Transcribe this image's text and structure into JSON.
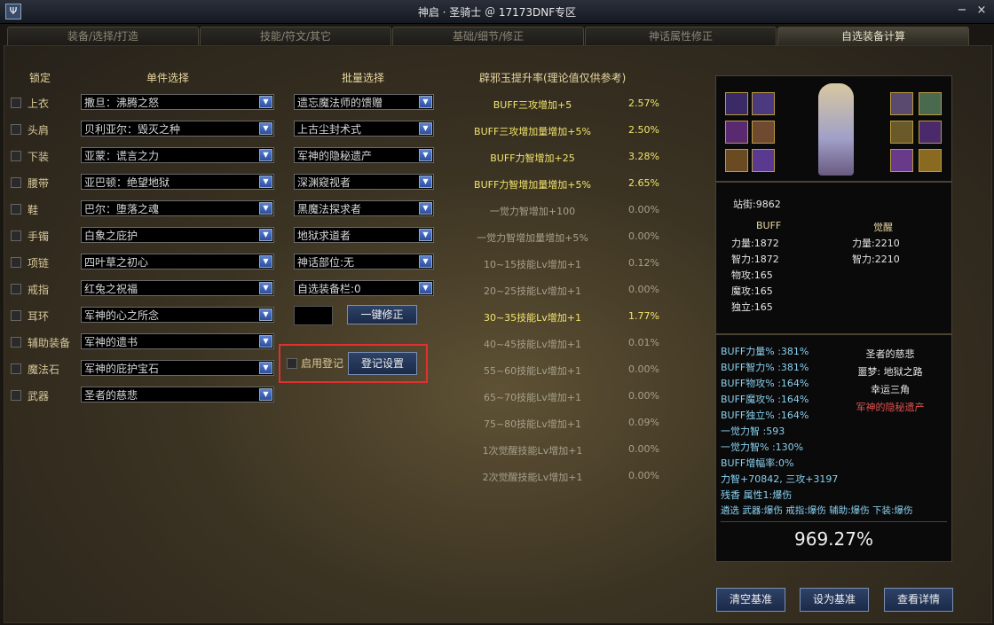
{
  "window": {
    "title": "神启 · 圣骑士 ＠ 17173DNF专区",
    "minimize": "−",
    "close": "×",
    "app_icon": "Ψ"
  },
  "tabs": [
    "装备/选择/打造",
    "技能/符文/其它",
    "基础/细节/修正",
    "神话属性修正",
    "自选装备计算"
  ],
  "active_tab": 4,
  "headers": {
    "lock": "锁定",
    "single": "单件选择",
    "batch": "批量选择",
    "rate": "辟邪玉提升率(理论值仅供参考)"
  },
  "slots": [
    {
      "label": "上衣",
      "item": "撒旦：沸腾之怒"
    },
    {
      "label": "头肩",
      "item": "贝利亚尔：毁灭之种"
    },
    {
      "label": "下装",
      "item": "亚蒙：谎言之力"
    },
    {
      "label": "腰带",
      "item": "亚巴顿：绝望地狱"
    },
    {
      "label": "鞋",
      "item": "巴尔：堕落之魂"
    },
    {
      "label": "手镯",
      "item": "白象之庇护"
    },
    {
      "label": "项链",
      "item": "四叶草之初心"
    },
    {
      "label": "戒指",
      "item": "红兔之祝福"
    },
    {
      "label": "耳环",
      "item": "军神的心之所念"
    },
    {
      "label": "辅助装备",
      "item": "军神的遗书"
    },
    {
      "label": "魔法石",
      "item": "军神的庇护宝石"
    },
    {
      "label": "武器",
      "item": "圣者的慈悲"
    }
  ],
  "batch": [
    "遗忘魔法师的馈赠",
    "上古尘封术式",
    "军神的隐秘遗产",
    "深渊窥视者",
    "黑魔法探求者",
    "地狱求道者",
    "神话部位:无",
    "自选装备栏:0"
  ],
  "buttons": {
    "one_key": "一键修正",
    "register_label": "启用登记",
    "register_settings": "登记设置",
    "clear": "清空基准",
    "set": "设为基准",
    "detail": "查看详情"
  },
  "rates": [
    {
      "name": "BUFF三攻增加+5",
      "pct": "2.57%",
      "hi": true
    },
    {
      "name": "BUFF三攻增加量增加+5%",
      "pct": "2.50%",
      "hi": true
    },
    {
      "name": "BUFF力智增加+25",
      "pct": "3.28%",
      "hi": true
    },
    {
      "name": "BUFF力智增加量增加+5%",
      "pct": "2.65%",
      "hi": true
    },
    {
      "name": "一觉力智增加+100",
      "pct": "0.00%",
      "hi": false
    },
    {
      "name": "一觉力智增加量增加+5%",
      "pct": "0.00%",
      "hi": false
    },
    {
      "name": "10~15技能Lv增加+1",
      "pct": "0.12%",
      "hi": false
    },
    {
      "name": "20~25技能Lv增加+1",
      "pct": "0.00%",
      "hi": false
    },
    {
      "name": "30~35技能Lv增加+1",
      "pct": "1.77%",
      "hi": true
    },
    {
      "name": "40~45技能Lv增加+1",
      "pct": "0.01%",
      "hi": false
    },
    {
      "name": "55~60技能Lv增加+1",
      "pct": "0.00%",
      "hi": false
    },
    {
      "name": "65~70技能Lv增加+1",
      "pct": "0.00%",
      "hi": false
    },
    {
      "name": "75~80技能Lv增加+1",
      "pct": "0.09%",
      "hi": false
    },
    {
      "name": "1次觉醒技能Lv增加+1",
      "pct": "0.00%",
      "hi": false
    },
    {
      "name": "2次觉醒技能Lv增加+1",
      "pct": "0.00%",
      "hi": false
    }
  ],
  "stats": {
    "street": "站街:9862",
    "buff_title": "BUFF",
    "awake_title": "觉醒",
    "buff": [
      "力量:1872",
      "智力:1872",
      "物攻:165",
      "魔攻:165",
      "独立:165"
    ],
    "awake": [
      "力量:2210",
      "智力:2210"
    ]
  },
  "details": {
    "lines": [
      "BUFF力量% :381%",
      "BUFF智力% :381%",
      "BUFF物攻% :164%",
      "BUFF魔攻% :164%",
      "BUFF独立% :164%",
      "一觉力智  :593",
      "一觉力智% :130%",
      "BUFF增幅率:0%"
    ],
    "right": [
      "圣者的慈悲",
      "噩梦: 地狱之路",
      "幸运三角"
    ],
    "right_red": "军神的隐秘遗产",
    "sum": "力智+70842, 三攻+3197",
    "line2": "残香 属性1:爆伤",
    "line3": "遴选 武器:爆伤 戒指:爆伤 辅助:爆伤 下装:爆伤",
    "total": "969.27%"
  },
  "colors": {
    "accent_yellow": "#f2e46c",
    "highlight_red": "#e03030",
    "select_arrow": "#2c4fa0"
  }
}
